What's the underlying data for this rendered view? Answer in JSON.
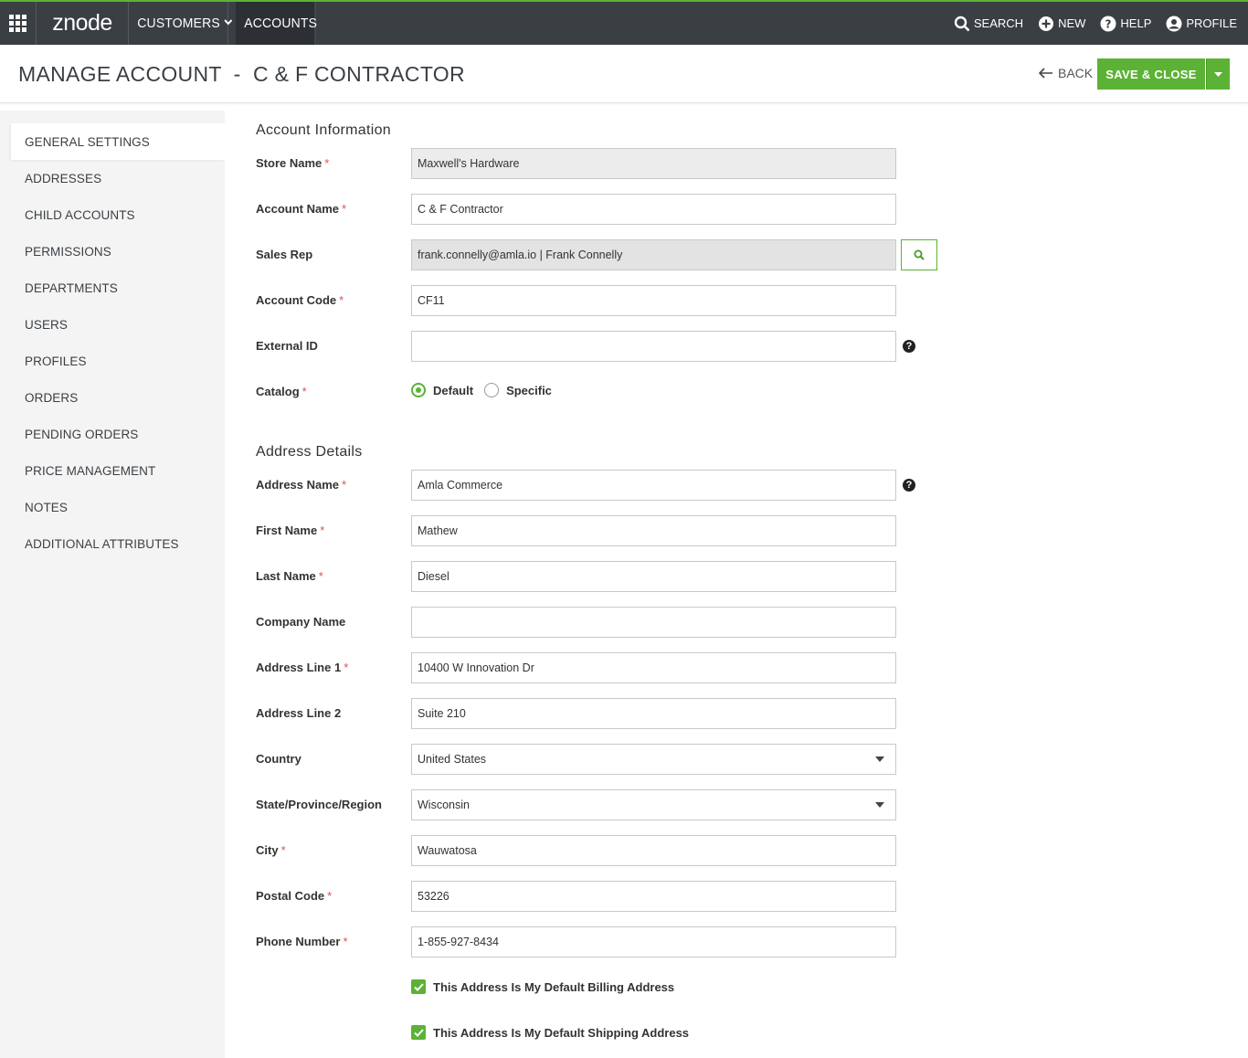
{
  "nav": {
    "logo": "znode",
    "customers_label": "CUSTOMERS",
    "accounts_label": "ACCOUNTS",
    "search_label": "SEARCH",
    "new_label": "NEW",
    "help_label": "HELP",
    "profile_label": "PROFILE"
  },
  "header": {
    "title": "MANAGE ACCOUNT  -  C & F CONTRACTOR",
    "back_label": "BACK",
    "save_label": "SAVE & CLOSE"
  },
  "sidebar": {
    "items": [
      {
        "label": "GENERAL SETTINGS",
        "active": true
      },
      {
        "label": "ADDRESSES"
      },
      {
        "label": "CHILD ACCOUNTS"
      },
      {
        "label": "PERMISSIONS"
      },
      {
        "label": "DEPARTMENTS"
      },
      {
        "label": "USERS"
      },
      {
        "label": "PROFILES"
      },
      {
        "label": "ORDERS"
      },
      {
        "label": "PENDING ORDERS"
      },
      {
        "label": "PRICE MANAGEMENT"
      },
      {
        "label": "NOTES"
      },
      {
        "label": "ADDITIONAL ATTRIBUTES"
      }
    ]
  },
  "account_info": {
    "title": "Account Information",
    "store_name": {
      "label": "Store Name",
      "value": "Maxwell's Hardware"
    },
    "account_name": {
      "label": "Account Name",
      "value": "C & F Contractor"
    },
    "sales_rep": {
      "label": "Sales Rep",
      "value": "frank.connelly@amla.io | Frank Connelly"
    },
    "account_code": {
      "label": "Account Code",
      "value": "CF11"
    },
    "external_id": {
      "label": "External ID",
      "value": ""
    },
    "catalog": {
      "label": "Catalog",
      "options": [
        "Default",
        "Specific"
      ],
      "selected": "Default"
    }
  },
  "address": {
    "title": "Address Details",
    "address_name": {
      "label": "Address Name",
      "value": "Amla Commerce"
    },
    "first_name": {
      "label": "First Name",
      "value": "Mathew"
    },
    "last_name": {
      "label": "Last Name",
      "value": "Diesel"
    },
    "company_name": {
      "label": "Company Name",
      "value": ""
    },
    "address_line1": {
      "label": "Address Line 1",
      "value": "10400 W Innovation Dr"
    },
    "address_line2": {
      "label": "Address Line 2",
      "value": "Suite 210"
    },
    "country": {
      "label": "Country",
      "value": "United States"
    },
    "state": {
      "label": "State/Province/Region",
      "value": "Wisconsin"
    },
    "city": {
      "label": "City",
      "value": "Wauwatosa"
    },
    "postal_code": {
      "label": "Postal Code",
      "value": "53226"
    },
    "phone": {
      "label": "Phone Number",
      "value": "1-855-927-8434"
    },
    "default_billing": {
      "label": "This Address Is My Default Billing Address",
      "checked": true
    },
    "default_shipping": {
      "label": "This Address Is My Default Shipping Address",
      "checked": true
    }
  },
  "colors": {
    "brand_green": "#5cb234",
    "nav_bg": "#3a3f44",
    "required_red": "#d9534f"
  }
}
